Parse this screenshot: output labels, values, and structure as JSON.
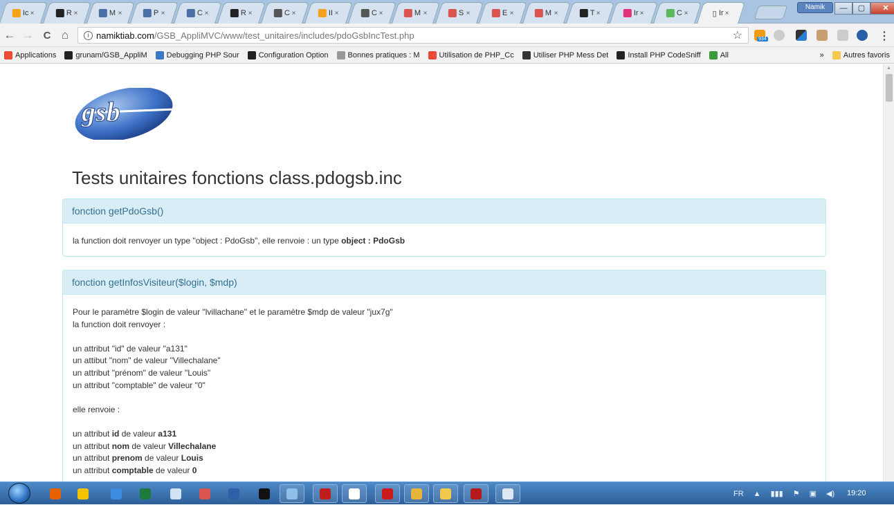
{
  "browser": {
    "tabs": [
      {
        "letter": "Ic",
        "color": "#f7a21b",
        "icon": "phpmyadmin-icon"
      },
      {
        "letter": "R",
        "color": "#222222",
        "icon": "github-icon"
      },
      {
        "letter": "M",
        "color": "#4a6fa5",
        "icon": "php-manual-icon"
      },
      {
        "letter": "P",
        "color": "#4a6fa5",
        "icon": "php-manual-icon"
      },
      {
        "letter": "C",
        "color": "#4a6fa5",
        "icon": "php-manual-icon"
      },
      {
        "letter": "R",
        "color": "#222222",
        "icon": "github-icon"
      },
      {
        "letter": "C",
        "color": "#555555",
        "icon": "doc-icon"
      },
      {
        "letter": "II",
        "color": "#f7a21b",
        "icon": "phpmyadmin-icon"
      },
      {
        "letter": "C",
        "color": "#555555",
        "icon": "doc-icon"
      },
      {
        "letter": "M",
        "color": "#d9534f",
        "icon": "site-icon"
      },
      {
        "letter": "S",
        "color": "#d9534f",
        "icon": "site-icon"
      },
      {
        "letter": "E",
        "color": "#d9534f",
        "icon": "site-icon"
      },
      {
        "letter": "M",
        "color": "#d9534f",
        "icon": "site-icon"
      },
      {
        "letter": "T",
        "color": "#222222",
        "icon": "github-icon"
      },
      {
        "letter": "Ir",
        "color": "#e0337a",
        "icon": "site-icon"
      },
      {
        "letter": "C",
        "color": "#5cb85c",
        "icon": "laravel-icon"
      }
    ],
    "active_tab": {
      "letter": "Ir",
      "icon": "page-icon"
    },
    "close_glyph": "×",
    "profile_name": "Namik",
    "window_controls": {
      "minimize": "—",
      "maximize": "▢",
      "close": "✕"
    },
    "nav": {
      "back": "←",
      "forward": "→",
      "reload": "C",
      "home": "⌂"
    },
    "url": {
      "info": "i",
      "host": "namiktiab.com",
      "path": "/GSB_AppliMVC/www/test_unitaires/includes/pdoGsbIncTest.php"
    },
    "star": "☆",
    "rss_badge": "934",
    "menu": "⋮",
    "bookmarks": [
      {
        "label": "Applications",
        "icon": "apps-grid-icon",
        "color": "#e94b35"
      },
      {
        "label": "grunam/GSB_AppliM",
        "icon": "github-icon",
        "color": "#222222"
      },
      {
        "label": "Debugging PHP Sour",
        "icon": "netbeans-icon",
        "color": "#3c78c8"
      },
      {
        "label": "Configuration Option",
        "icon": "github-icon",
        "color": "#222222"
      },
      {
        "label": "Bonnes pratiques : M",
        "icon": "page-icon",
        "color": "#999999"
      },
      {
        "label": "Utilisation de PHP_Cc",
        "icon": "site-icon",
        "color": "#e94b35"
      },
      {
        "label": "Utiliser PHP Mess Det",
        "icon": "site-icon",
        "color": "#333333"
      },
      {
        "label": "Install PHP CodeSniff",
        "icon": "site-icon",
        "color": "#222222"
      },
      {
        "label": "All",
        "icon": "site-icon",
        "color": "#3c9a3c"
      }
    ],
    "bookmarks_overflow": "»",
    "other_bookmarks": "Autres favoris"
  },
  "page": {
    "logo_text": "gsb",
    "title": "Tests unitaires fonctions class.pdogsb.inc",
    "panels": [
      {
        "heading": "fonction getPdoGsb()",
        "body": {
          "text": "la function doit renvoyer un type \"object : PdoGsb\", elle renvoie : un type ",
          "bold": "object : PdoGsb"
        }
      },
      {
        "heading": "fonction getInfosVisiteur($login, $mdp)",
        "intro": [
          "Pour le paramètre $login de valeur \"lvillachane\" et le paramètre $mdp de valeur \"jux7g\"",
          "la function doit renvoyer :"
        ],
        "expected": [
          "un attribut \"id\" de valeur \"a131\"",
          "un attibut \"nom\" de valeur \"Villechalane\"",
          "un attribut \"prénom\" de valeur \"Louis\"",
          "un attribut \"comptable\" de valeur \"0\""
        ],
        "returns_label": "elle renvoie :",
        "actual": [
          {
            "pre": "un attribut ",
            "key": "id",
            "mid": " de valeur ",
            "val": "a131"
          },
          {
            "pre": "un attribut ",
            "key": "nom",
            "mid": " de valeur ",
            "val": "Villechalane"
          },
          {
            "pre": "un attribut ",
            "key": "prenom",
            "mid": " de valeur ",
            "val": "Louis"
          },
          {
            "pre": "un attribut ",
            "key": "comptable",
            "mid": " de valeur ",
            "val": "0"
          }
        ]
      }
    ]
  },
  "taskbar": {
    "apps": [
      {
        "icon": "firefox-icon",
        "color": "#e66000"
      },
      {
        "icon": "paint-app-icon",
        "color": "#f4c300"
      },
      {
        "icon": "ie-icon",
        "color": "#3a8de0"
      },
      {
        "icon": "publisher-icon",
        "color": "#1e7a3c"
      },
      {
        "icon": "notepad-icon",
        "color": "#cfe2f6"
      },
      {
        "icon": "snipping-tool-icon",
        "color": "#d9534f"
      },
      {
        "icon": "virtualbox-icon",
        "color": "#2f5fa8"
      },
      {
        "icon": "cmd-icon",
        "color": "#111111"
      },
      {
        "icon": "paint-icon",
        "color": "#8ec0ea"
      },
      {
        "icon": "filezilla-icon",
        "color": "#bf1e1e"
      },
      {
        "icon": "document-icon",
        "color": "#ffffff"
      },
      {
        "icon": "opera-icon",
        "color": "#cc1b1b"
      },
      {
        "icon": "chrome-icon",
        "color": "#e9b43a"
      },
      {
        "icon": "explorer-icon",
        "color": "#f2c94c"
      },
      {
        "icon": "acrobat-icon",
        "color": "#b31b1b"
      },
      {
        "icon": "window-icon",
        "color": "#dde8f5"
      }
    ],
    "language": "FR",
    "clock": "19:20"
  }
}
